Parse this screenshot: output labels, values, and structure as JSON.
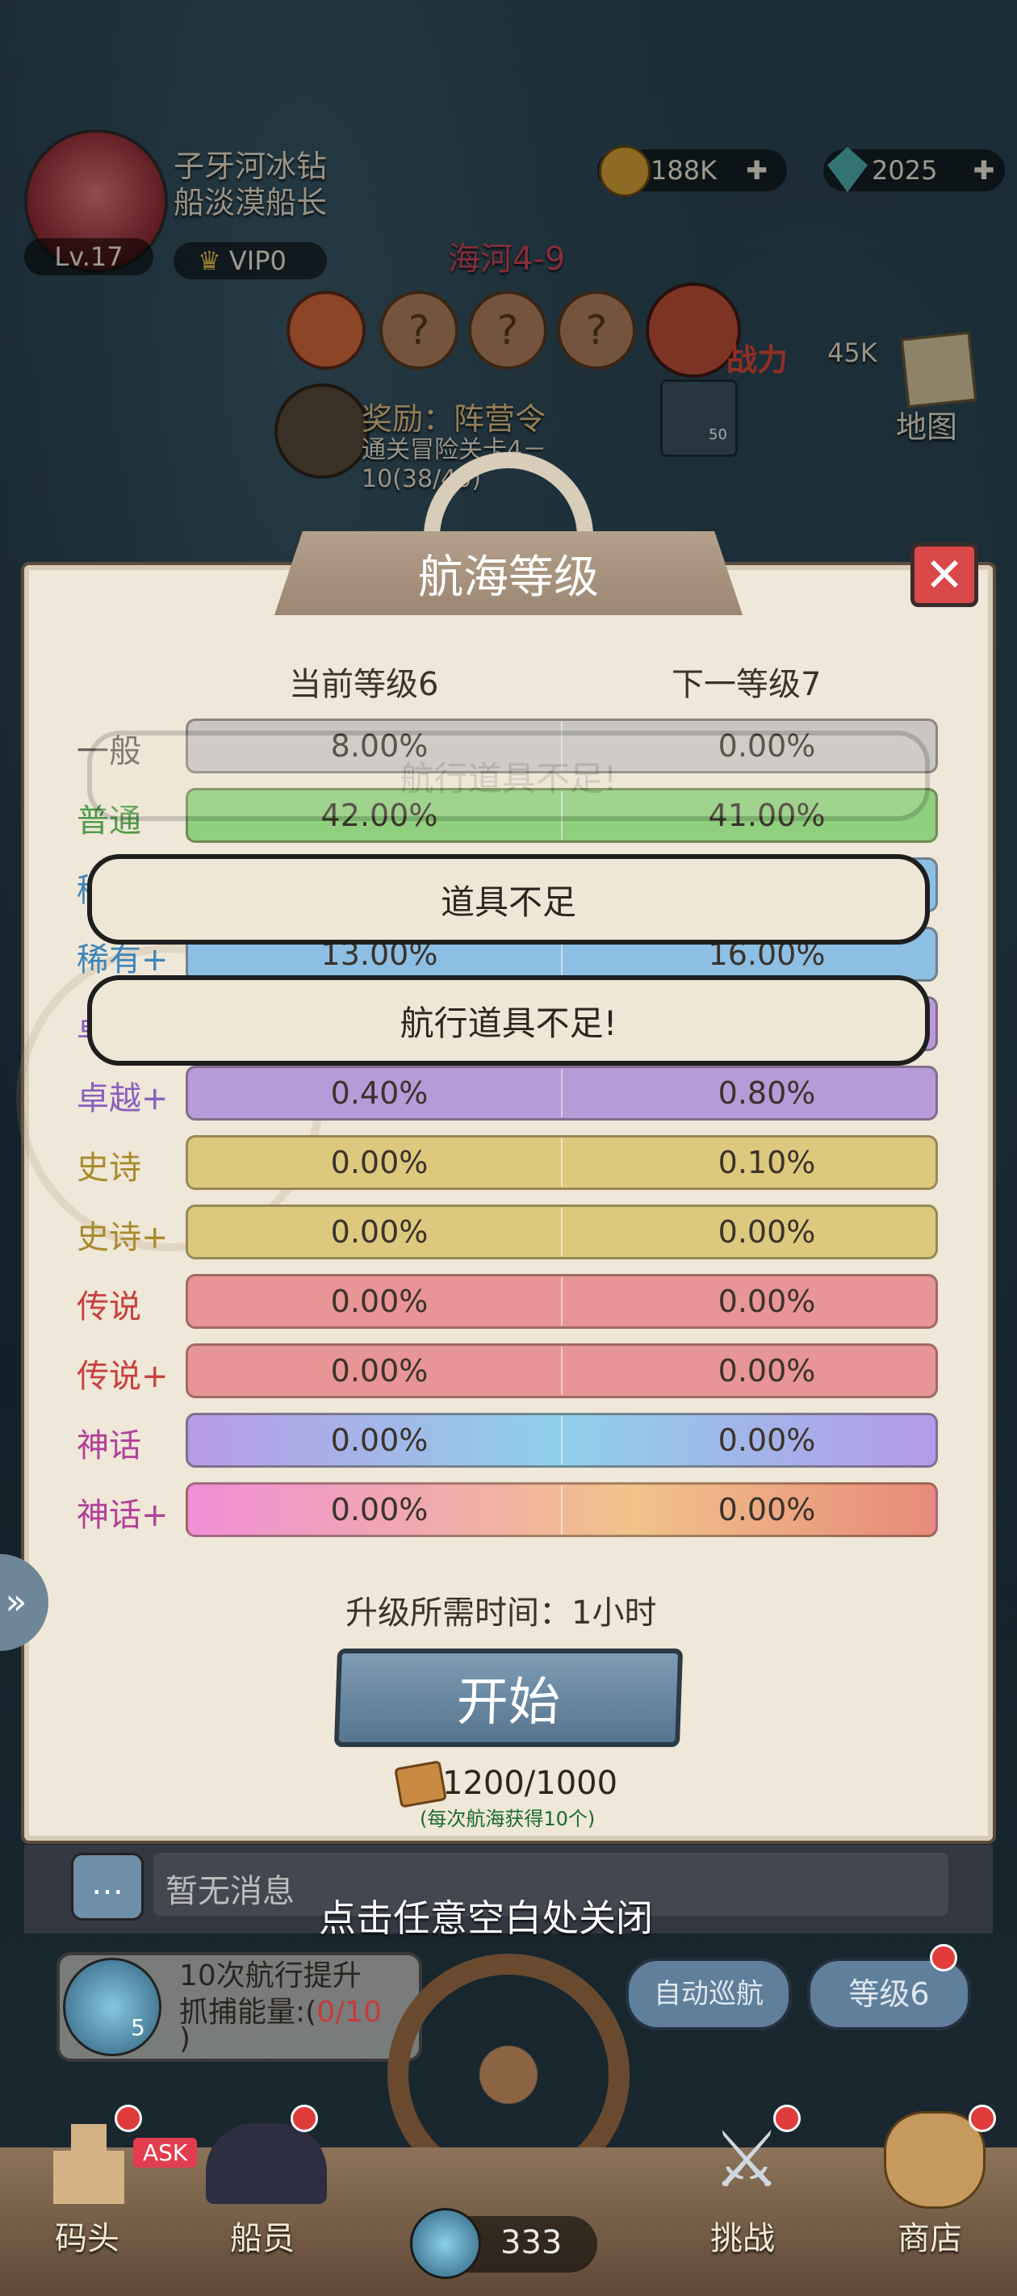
{
  "player": {
    "name_line1": "子牙河冰钻",
    "name_line2": "船淡漠船长",
    "level": "Lv.17",
    "vip": "VIP0"
  },
  "currency": {
    "gold": "188K",
    "gems": "2025"
  },
  "stage": {
    "name": "海河4-9",
    "power_label": "战力",
    "power_value": "45K",
    "map_label": "地图",
    "reward": "奖励：阵营令",
    "requirement": "通关冒险关卡4－10(38/40)",
    "reward_count": "50"
  },
  "dialog": {
    "title": "航海等级",
    "current_level": "当前等级6",
    "next_level": "下一等级7",
    "rows": [
      {
        "label": "一般",
        "current": "8.00%",
        "next": "0.00%"
      },
      {
        "label": "普通",
        "current": "42.00%",
        "next": "41.00%"
      },
      {
        "label": "稀有",
        "current": "",
        "next": ""
      },
      {
        "label": "稀有+",
        "current": "13.00%",
        "next": "16.00%"
      },
      {
        "label": "卓越",
        "current": "",
        "next": ""
      },
      {
        "label": "卓越+",
        "current": "0.40%",
        "next": "0.80%"
      },
      {
        "label": "史诗",
        "current": "0.00%",
        "next": "0.10%"
      },
      {
        "label": "史诗+",
        "current": "0.00%",
        "next": "0.00%"
      },
      {
        "label": "传说",
        "current": "0.00%",
        "next": "0.00%"
      },
      {
        "label": "传说+",
        "current": "0.00%",
        "next": "0.00%"
      },
      {
        "label": "神话",
        "current": "0.00%",
        "next": "0.00%"
      },
      {
        "label": "神话+",
        "current": "0.00%",
        "next": "0.00%"
      }
    ],
    "toast_faded": "航行道具不足!",
    "toast_1": "道具不足",
    "toast_2": "航行道具不足!",
    "upgrade_time": "升级所需时间：1小时",
    "start_button": "开始",
    "cost": "1200/1000",
    "cost_note": "(每次航海获得10个)"
  },
  "close_hint": "点击任意空白处关闭",
  "chat": {
    "placeholder": "暂无消息"
  },
  "voyage": {
    "count_badge": "5",
    "line1": "10次航行提升",
    "line2": "抓捕能量:(",
    "progress": "0/10",
    "line3": ")"
  },
  "buttons": {
    "auto_cruise": "自动巡航",
    "level": "等级6"
  },
  "nav": {
    "dock": "码头",
    "crew": "船员",
    "ask": "ASK",
    "energy": "333",
    "challenge": "挑战",
    "shop": "商店"
  },
  "colors": {
    "common": "#c9c6c4",
    "normal": "#8fcf7e",
    "rare": "#8cbfe3",
    "excellent": "#b79ad8",
    "epic": "#ddc97e",
    "legend": "#e89595"
  }
}
